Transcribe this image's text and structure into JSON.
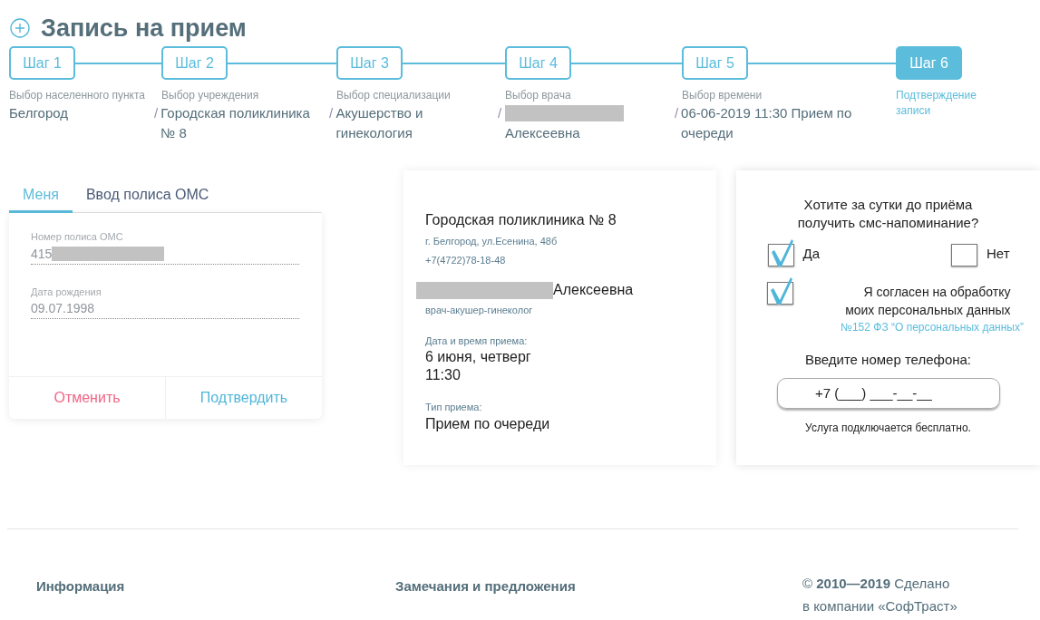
{
  "title": "Запись на прием",
  "steps": [
    {
      "label": "Шаг 1",
      "selected": false,
      "caption": "Выбор населенного пункта",
      "value": "Белгород"
    },
    {
      "label": "Шаг 2",
      "selected": false,
      "caption": "Выбор учреждения",
      "separator": "/",
      "value": "Городская поликлиника № 8"
    },
    {
      "label": "Шаг 3",
      "selected": false,
      "caption": "Выбор специализации",
      "separator": "/",
      "value": "Акушерство и гинекология"
    },
    {
      "label": "Шаг 4",
      "selected": false,
      "caption": "Выбор врача",
      "separator": "/",
      "value": "Алексеевна",
      "redacted": true
    },
    {
      "label": "Шаг 5",
      "selected": false,
      "caption": "Выбор времени",
      "separator": "/",
      "value": "06-06-2019 11:30 Прием по очереди"
    },
    {
      "label": "Шаг 6",
      "selected": true,
      "caption": "Подтверждение записи"
    }
  ],
  "policy_tabs": [
    {
      "label": "Меня",
      "selected": true
    },
    {
      "label": "Ввод полиса ОМС",
      "selected": false
    }
  ],
  "policy_form": {
    "fields": [
      {
        "label": "Номер полиса ОМС",
        "value": "415",
        "redacted": true
      },
      {
        "label": "Дата рождения",
        "value": "09.07.1998"
      }
    ],
    "buttons": [
      {
        "label": "Отменить",
        "kind": "cancel"
      },
      {
        "label": "Подтвердить",
        "kind": "confirm"
      }
    ]
  },
  "summary": {
    "clinic": "Городская поликлиника № 8",
    "address": "г. Белгород, ул.Есенина, 48б",
    "phone": "+7(4722)78-18-48",
    "doctor": "Алексеевна",
    "doctor_redacted": true,
    "specialty": "врач-акушер-гинеколог",
    "items": [
      {
        "label": "Дата и время приема:",
        "lines": [
          "6 июня, четверг",
          "11:30"
        ]
      },
      {
        "label": "Тип приема:",
        "lines": [
          "Прием по очереди"
        ]
      }
    ]
  },
  "sms": {
    "question": "Хотите за сутки до приёма получить смс-напоминание?",
    "options": [
      {
        "label": "Да",
        "checked": true
      },
      {
        "label": "Нет",
        "checked": false
      }
    ],
    "consent": {
      "label": "Я согласен на обработку моих персональных данных",
      "checked": true,
      "link": "№152 ФЗ “О персональных данных”"
    },
    "phone_label": "Введите номер телефона:",
    "phone_placeholder": "+7 (___) ___-__-__",
    "note": "Услуга подключается бесплатно."
  },
  "footer": {
    "links": [
      "Информация",
      "Замечания и предложения"
    ],
    "copyright": "© **2010—2019** Сделано",
    "company": "в компании «СофТраст»"
  }
}
